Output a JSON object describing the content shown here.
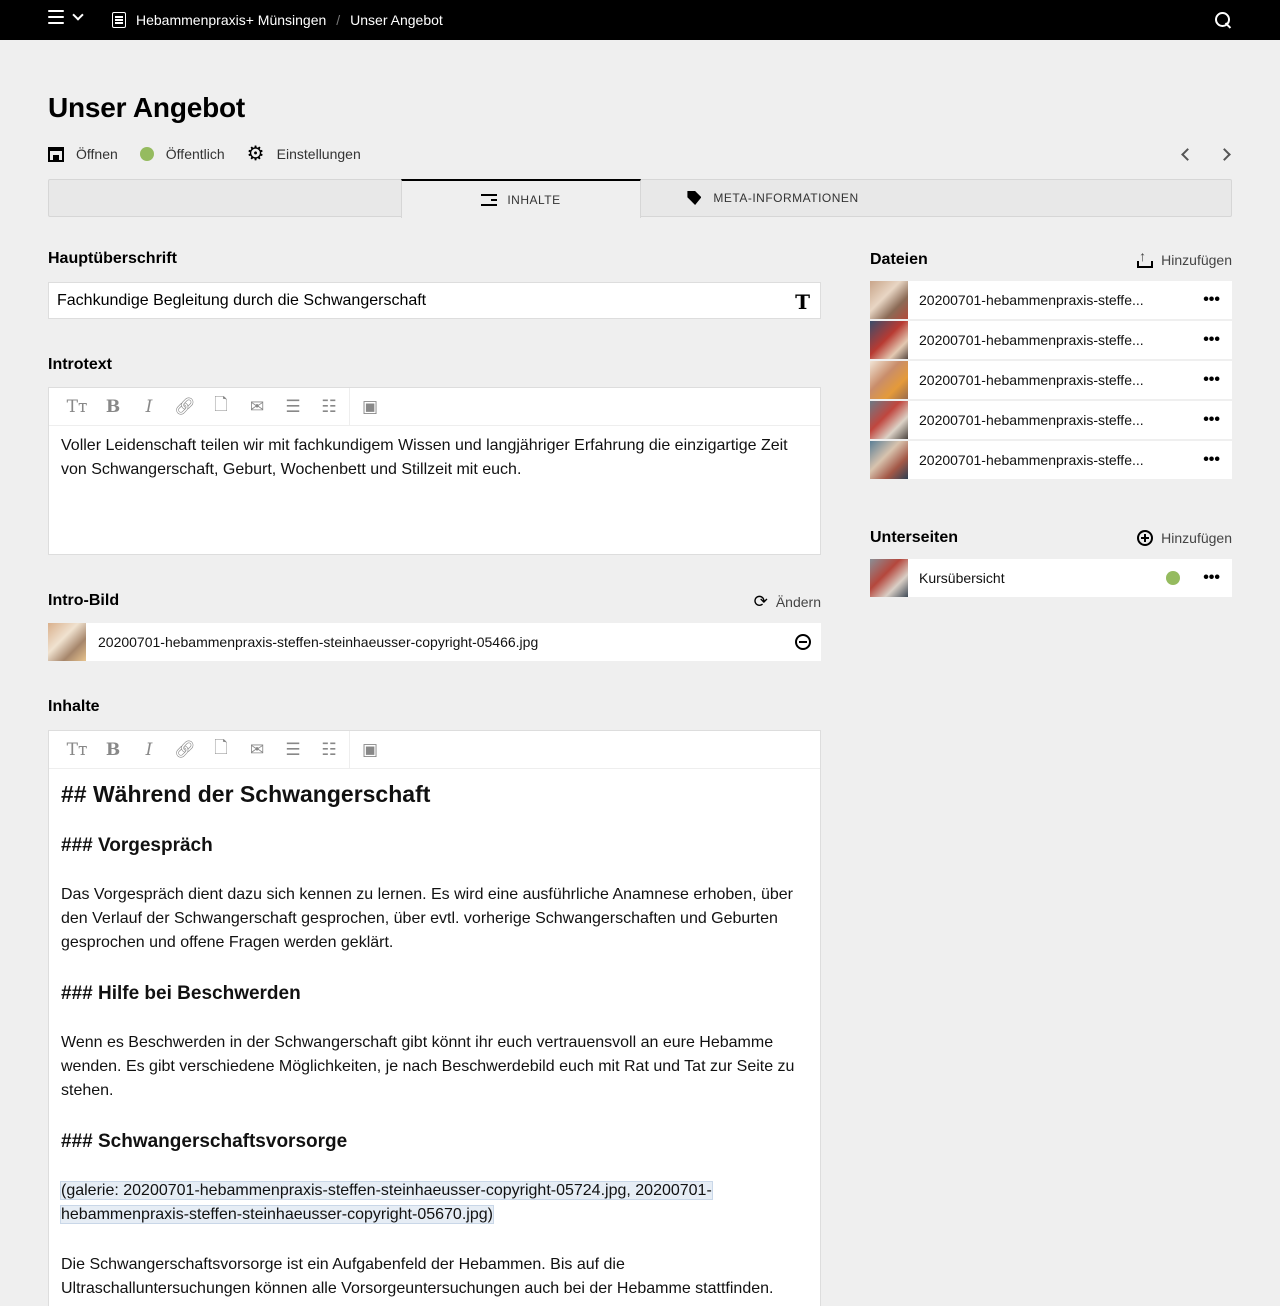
{
  "topbar": {
    "breadcrumbs": [
      "Hebammenpraxis+ Münsingen",
      "Unser Angebot"
    ],
    "separator": "/"
  },
  "page": {
    "title": "Unser Angebot",
    "options": {
      "open_label": "Öffnen",
      "status_label": "Öffentlich",
      "status_color": "#95bb5f",
      "settings_label": "Einstellungen"
    }
  },
  "tabs": [
    {
      "label": "INHALTE",
      "icon": "text-lines-icon",
      "active": true
    },
    {
      "label": "META-INFORMATIONEN",
      "icon": "tag-icon",
      "active": false
    }
  ],
  "fields": {
    "headline": {
      "label": "Hauptüberschrift",
      "value": "Fachkundige Begleitung durch die Schwangerschaft"
    },
    "introtext": {
      "label": "Introtext",
      "value": "Voller Leidenschaft teilen wir mit fachkundigem Wissen und langjähriger Erfahrung die einzigartige Zeit von Schwangerschaft, Geburt, Wochenbett und Stillzeit mit euch."
    },
    "intro_image": {
      "label": "Intro-Bild",
      "change_label": "Ändern",
      "filename": "20200701-hebammenpraxis-steffen-steinhaeusser-copyright-05466.jpg"
    },
    "contents": {
      "label": "Inhalte",
      "h2": "## Während der Schwangerschaft",
      "h3_1": "### Vorgespräch",
      "p1": "Das Vorgespräch dient dazu sich kennen zu lernen. Es wird eine ausführliche Anamnese erhoben, über den Verlauf der Schwangerschaft gesprochen, über evtl. vorherige Schwangerschaften und  Geburten gesprochen und offene Fragen werden geklärt.",
      "h3_2": "### Hilfe bei Beschwerden",
      "p2": "Wenn es Beschwerden in der Schwangerschaft gibt könnt ihr euch vertrauensvoll an eure Hebamme wenden. Es gibt verschiedene Möglichkeiten, je nach Beschwerdebild euch mit Rat und Tat zur Seite zu stehen.",
      "h3_3": "### Schwangerschaftsvorsorge",
      "gallery": "(galerie: 20200701-hebammenpraxis-steffen-steinhaeusser-copyright-05724.jpg, 20200701-hebammenpraxis-steffen-steinhaeusser-copyright-05670.jpg)",
      "p3": "Die Schwangerschaftsvorsorge ist ein Aufgabenfeld der Hebammen. Bis auf die Ultraschalluntersuchungen können alle Vorsorgeuntersuchungen auch bei der Hebamme stattfinden."
    }
  },
  "toolbar_icons": [
    "headings-icon",
    "bold-icon",
    "italic-icon",
    "link-icon",
    "file-icon",
    "email-icon",
    "bullet-list-icon",
    "numbered-list-icon",
    "image-icon"
  ],
  "sidebar": {
    "files": {
      "title": "Dateien",
      "add_label": "Hinzufügen",
      "items": [
        {
          "name": "20200701-hebammenpraxis-steffe..."
        },
        {
          "name": "20200701-hebammenpraxis-steffe..."
        },
        {
          "name": "20200701-hebammenpraxis-steffe..."
        },
        {
          "name": "20200701-hebammenpraxis-steffe..."
        },
        {
          "name": "20200701-hebammenpraxis-steffe..."
        }
      ]
    },
    "subpages": {
      "title": "Unterseiten",
      "add_label": "Hinzufügen",
      "items": [
        {
          "name": "Kursübersicht",
          "status_color": "#95bb5f"
        }
      ]
    }
  }
}
